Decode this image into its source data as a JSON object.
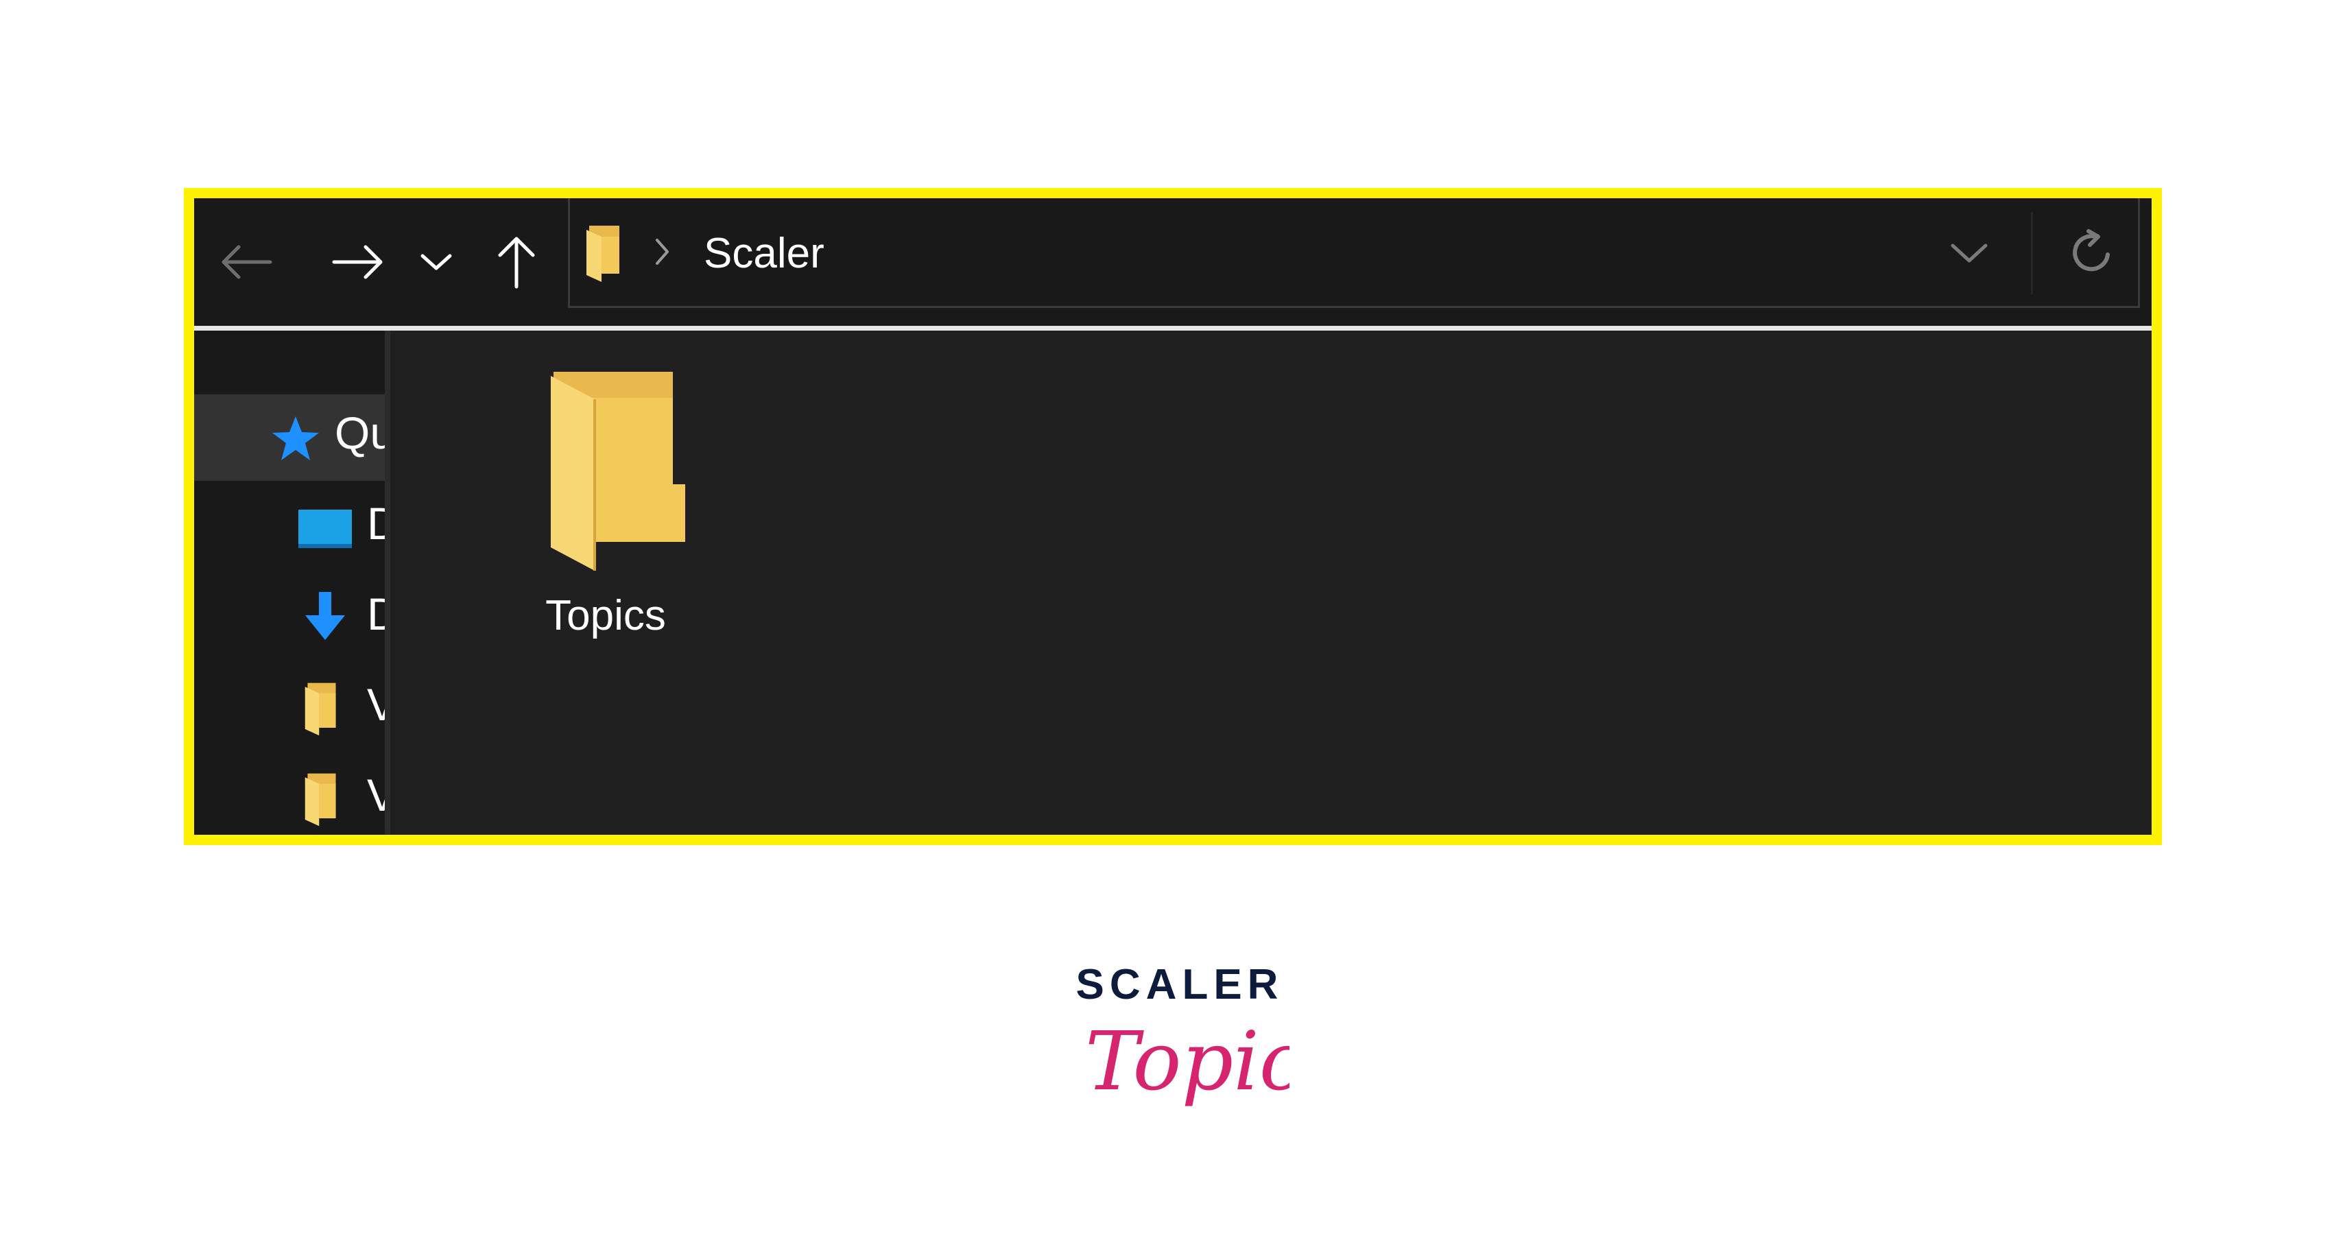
{
  "address_bar": {
    "path": "Scaler"
  },
  "navigation_pane": {
    "items": [
      {
        "label": "Qu",
        "icon": "star-icon",
        "selected": true
      },
      {
        "label": "D",
        "icon": "desktop-icon",
        "selected": false
      },
      {
        "label": "D",
        "icon": "download-icon",
        "selected": false
      },
      {
        "label": "V",
        "icon": "folder-icon",
        "selected": false
      },
      {
        "label": "V",
        "icon": "folder-icon",
        "selected": false
      }
    ]
  },
  "files": [
    {
      "name": "Topics",
      "icon": "folder-icon"
    }
  ],
  "logo": {
    "wordmark": "SCALER",
    "script": "Topics"
  },
  "colors": {
    "highlight_border": "#fef200",
    "window_bg": "#202020",
    "toolbar_bg": "#191919",
    "folder_yellow": "#f8d775",
    "accent_blue": "#1e90ff",
    "logo_navy": "#0d1b3d",
    "logo_pink": "#d6246e"
  }
}
